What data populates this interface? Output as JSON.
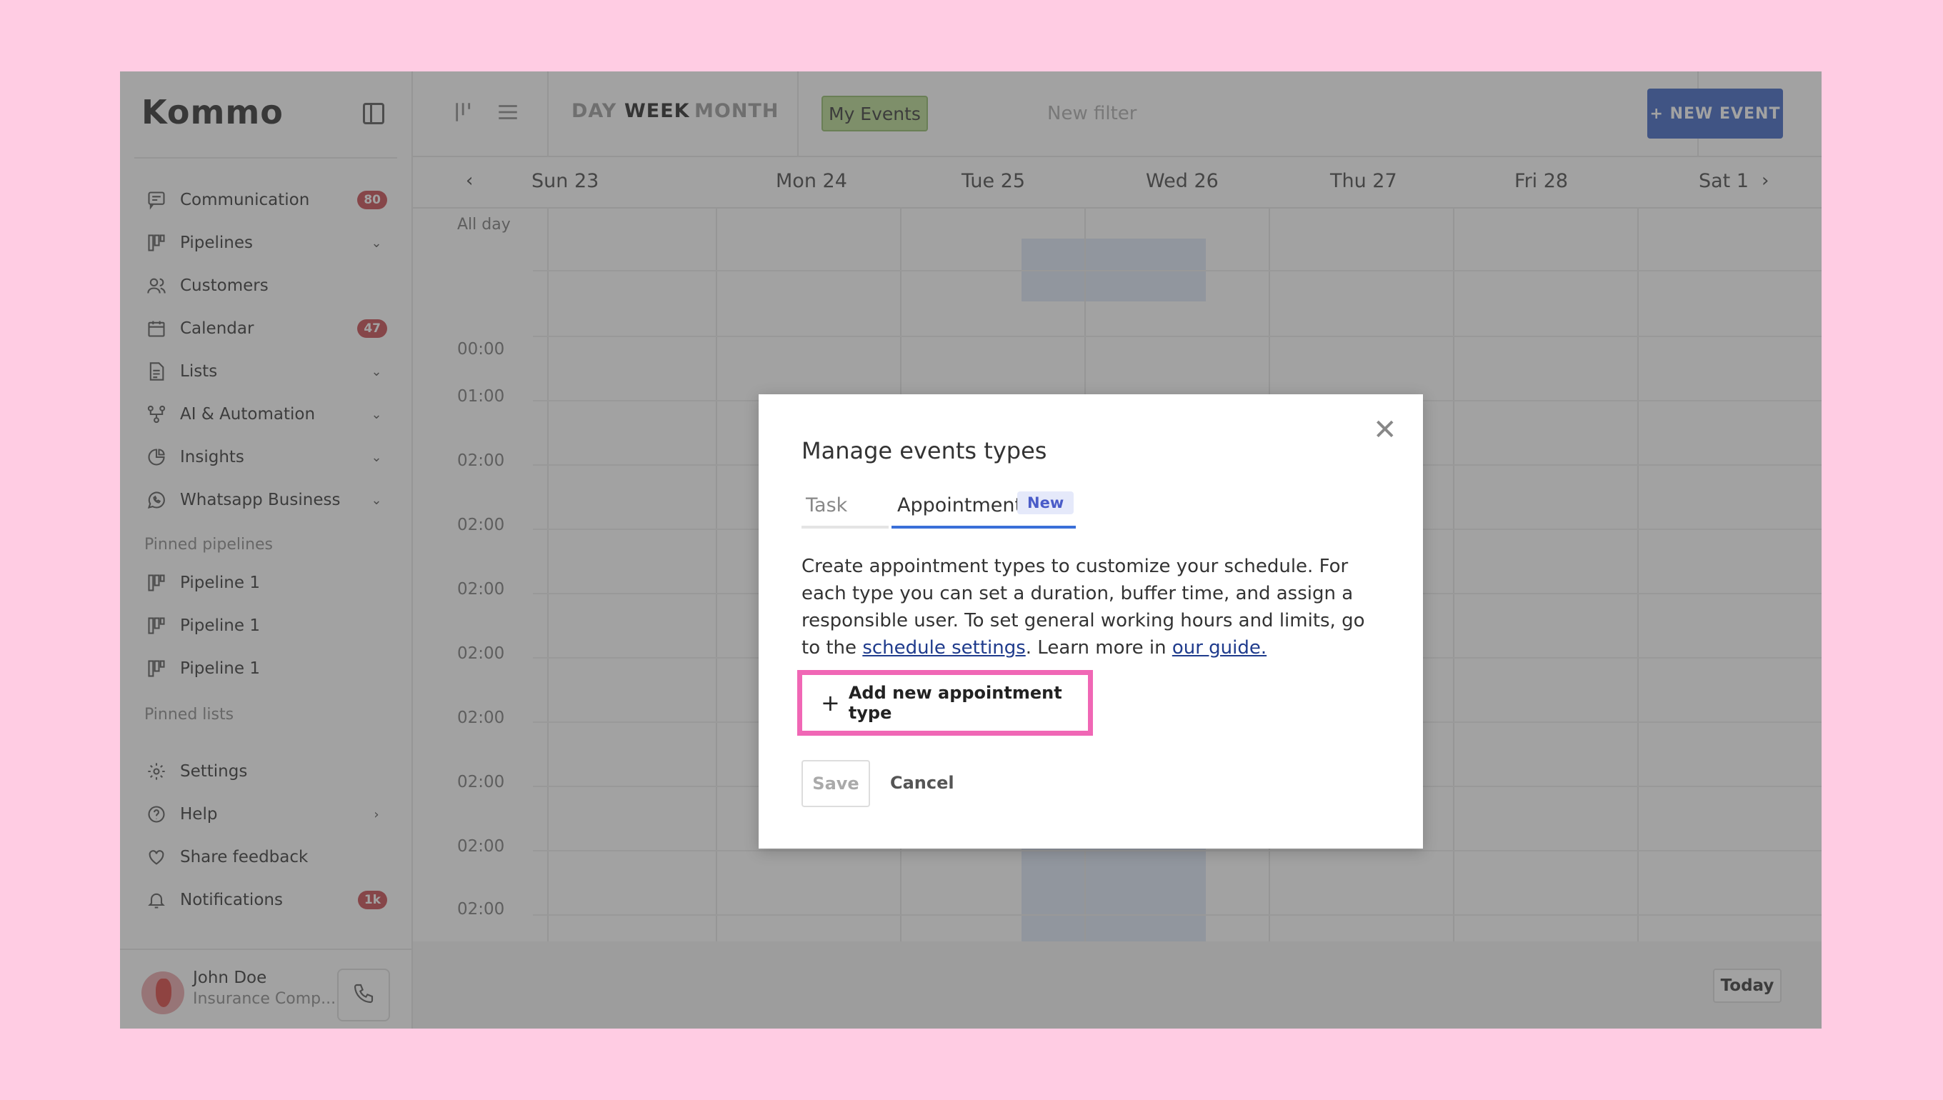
{
  "app": {
    "logo": "Kommo"
  },
  "sidebar": {
    "items": [
      {
        "label": "Communication",
        "badge": "80",
        "icon": "chat-icon"
      },
      {
        "label": "Pipelines",
        "icon": "pipeline-icon"
      },
      {
        "label": "Customers",
        "icon": "users-icon"
      },
      {
        "label": "Calendar",
        "badge": "47",
        "icon": "calendar-icon"
      },
      {
        "label": "Lists",
        "icon": "list-icon"
      },
      {
        "label": "AI & Automation",
        "icon": "automation-icon"
      },
      {
        "label": "Insights",
        "icon": "pie-chart-icon"
      },
      {
        "label": "Whatsapp Business",
        "icon": "whatsapp-icon"
      }
    ],
    "pinned_pipelines_label": "Pinned pipelines",
    "pinned_pipelines": [
      "Pipeline 1",
      "Pipeline 1",
      "Pipeline 1"
    ],
    "pinned_lists_label": "Pinned lists",
    "bottom_items": [
      {
        "label": "Settings",
        "icon": "gear-icon"
      },
      {
        "label": "Help",
        "icon": "help-icon"
      },
      {
        "label": "Share feedback",
        "icon": "heart-icon"
      },
      {
        "label": "Notifications",
        "badge": "1k",
        "icon": "bell-icon"
      }
    ],
    "profile": {
      "name": "John Doe",
      "company": "Insurance Comp..."
    }
  },
  "toolbar": {
    "ranges": [
      "DAY",
      "WEEK",
      "MONTH"
    ],
    "active_range": "WEEK",
    "filter_chip": "My Events",
    "filter_placeholder": "New filter",
    "more": "···",
    "new_event": "+ NEW EVENT"
  },
  "calendar": {
    "days": [
      "Sun 23",
      "Mon 24",
      "Tue 25",
      "Wed 26",
      "Thu 27",
      "Fri 28",
      "Sat 1"
    ],
    "all_day": "All day",
    "times": [
      "00:00",
      "01:00",
      "02:00",
      "02:00",
      "02:00",
      "02:00",
      "02:00",
      "02:00",
      "02:00",
      "02:00"
    ],
    "today_button": "Today"
  },
  "modal": {
    "title": "Manage events types",
    "tabs": [
      {
        "label": "Task"
      },
      {
        "label": "Appointment",
        "tag": "New"
      }
    ],
    "desc_part1": "Create appointment types to customize your schedule. For each type you can set a duration, buffer time, and assign a responsible user. To set general working hours and limits, go to the ",
    "desc_link1": "schedule settings",
    "desc_part2": ". Learn more in ",
    "desc_link2": "our guide.",
    "add_button": "Add new appointment type",
    "save": "Save",
    "cancel": "Cancel"
  }
}
